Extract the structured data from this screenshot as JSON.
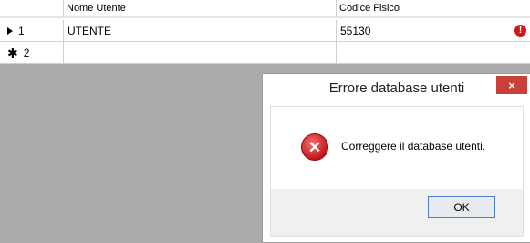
{
  "grid": {
    "columns": [
      "Nome Utente",
      "Codice Fisico"
    ],
    "rows": [
      {
        "index": "1",
        "marker": "current-row-arrow",
        "nome_utente": "UTENTE",
        "codice_fisico": "55130",
        "has_error": true
      },
      {
        "index": "2",
        "marker": "new-row-asterisk",
        "nome_utente": "",
        "codice_fisico": "",
        "has_error": false
      }
    ],
    "new_row_symbol": "✱",
    "error_symbol": "!"
  },
  "dialog": {
    "title": "Errore database utenti",
    "close_label": "×",
    "message": "Correggere il database utenti.",
    "icon": "error-icon",
    "icon_symbol": "✕",
    "ok_label": "OK"
  },
  "colors": {
    "error_red": "#d8141a",
    "close_button": "#c9403a",
    "backdrop_gray": "#ababab"
  }
}
